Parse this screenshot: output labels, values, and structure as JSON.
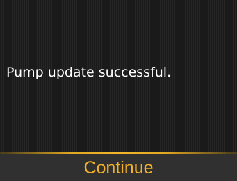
{
  "screen": {
    "message": "Pump update successful."
  },
  "footer": {
    "continue_label": "Continue"
  },
  "colors": {
    "accent": "#f2b127",
    "background": "#1c1c1c",
    "footer_background": "#303030",
    "text": "#ffffff"
  }
}
